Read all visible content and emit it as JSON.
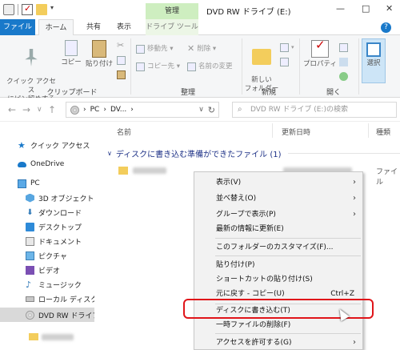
{
  "titlebar": {
    "manage_tab": "管理",
    "window_title": "DVD RW ドライブ (E:)",
    "minimize": "—",
    "restore": "□",
    "close": "✕"
  },
  "ribbon_tabs": {
    "file": "ファイル",
    "home": "ホーム",
    "share": "共有",
    "view": "表示",
    "drive_tools": "ドライブ ツール",
    "help": "?"
  },
  "ribbon": {
    "pin_label": "クイック アクセス\nにピン留めする",
    "copy_label": "コピー",
    "paste_label": "貼り付け",
    "clipboard_group": "クリップボード",
    "move_to": "移動先 ▾",
    "copy_to": "コピー先 ▾",
    "delete": "削除 ▾",
    "rename": "名前の変更",
    "organize_group": "整理",
    "new_folder": "新しい\nフォルダー",
    "new_group": "新規",
    "properties": "プロパティ",
    "open_group": "開く",
    "select": "選択"
  },
  "address": {
    "back": "←",
    "forward": "→",
    "recent": "∨",
    "up": "↑",
    "path_pc": "PC",
    "path_dvd": "DV...",
    "path_sep": "›",
    "dropdown": "∨",
    "refresh": "↻",
    "search_placeholder": "DVD RW ドライブ (E:)の検索"
  },
  "nav": {
    "quick_access": "クイック アクセス",
    "onedrive": "OneDrive",
    "pc": "PC",
    "objects3d": "3D オブジェクト",
    "downloads": "ダウンロード",
    "desktop": "デスクトップ",
    "documents": "ドキュメント",
    "pictures": "ピクチャ",
    "videos": "ビデオ",
    "music": "ミュージック",
    "local_disk": "ローカル ディスク (C",
    "dvd_drive": "DVD RW ドライブ ("
  },
  "filepane": {
    "col_name": "名前",
    "col_date": "更新日時",
    "col_type": "種類",
    "group_header": "ディスクに書き込む準備ができたファイル (1)",
    "file_type": "ファイル"
  },
  "context_menu": {
    "view": "表示(V)",
    "sort_by": "並べ替え(O)",
    "group_by": "グループで表示(P)",
    "refresh": "最新の情報に更新(E)",
    "customize": "このフォルダーのカスタマイズ(F)...",
    "paste": "貼り付け(P)",
    "paste_shortcut": "ショートカットの貼り付け(S)",
    "undo_copy": "元に戻す - コピー(U)",
    "undo_shortcut": "Ctrl+Z",
    "burn_to_disc": "ディスクに書き込む(T)",
    "delete_temp": "一時ファイルの削除(F)",
    "give_access": "アクセスを許可する(G)",
    "submenu_arrow": "›"
  },
  "colors": {
    "accent": "#1979ca",
    "manage_tab": "#ceeec0",
    "highlight_box": "#e0151a"
  }
}
